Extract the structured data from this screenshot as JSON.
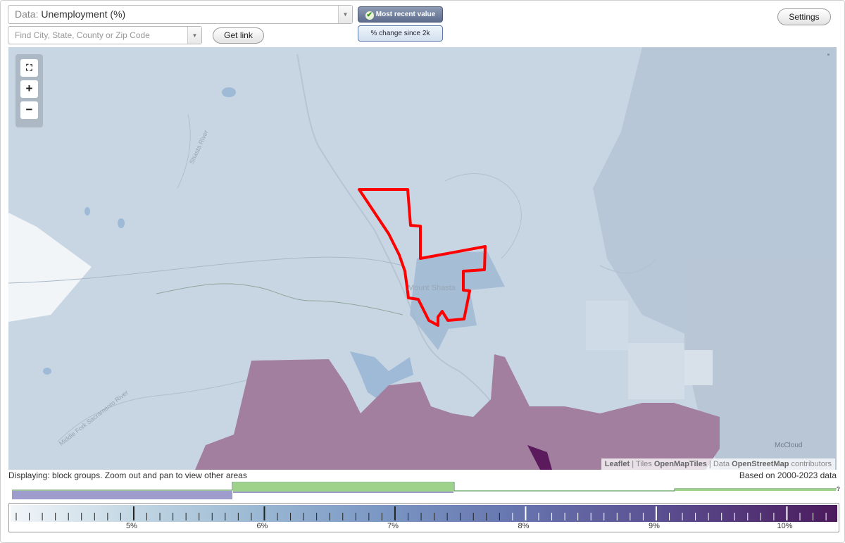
{
  "data_select": {
    "prefix": "Data:",
    "value": "Unemployment (%)"
  },
  "search": {
    "placeholder": "Find City, State, County or Zip Code"
  },
  "buttons": {
    "get_link": "Get link",
    "settings": "Settings"
  },
  "toggles": {
    "active": "Most recent value",
    "inactive": "% change since 2k"
  },
  "zoom": {
    "full_extent_icon": "fullscreen-icon",
    "zoom_in": "+",
    "zoom_out": "−"
  },
  "map": {
    "place_labels": {
      "city": "Mount Shasta",
      "mccloud": "McCloud"
    },
    "river_labels": {
      "shasta_river": "Shasta River",
      "middle_fork": "Middle Fork Sacramento River"
    }
  },
  "attribution": {
    "leaflet": "Leaflet",
    "sep1": "|",
    "tiles_label": "Tiles",
    "tiles": "OpenMapTiles",
    "sep2": "|",
    "data_label": "Data",
    "data": "OpenStreetMap",
    "contributors": "contributors"
  },
  "status": {
    "displaying": "Displaying: block groups. Zoom out and pan to view other areas",
    "based_on": "Based on 2000-2023 data"
  },
  "legend": {
    "tick_labels": [
      "5%",
      "6%",
      "7%",
      "8%",
      "9%",
      "10%"
    ],
    "histogram_help": "?"
  },
  "colors": {
    "selected_outline": "#ff0000",
    "low_class": "#c8d6e3",
    "high_class": "#a27f9f",
    "highest_class": "#5a1a5c",
    "histogram_green": "#9ed18a",
    "histogram_purple": "#9e9ccc"
  }
}
